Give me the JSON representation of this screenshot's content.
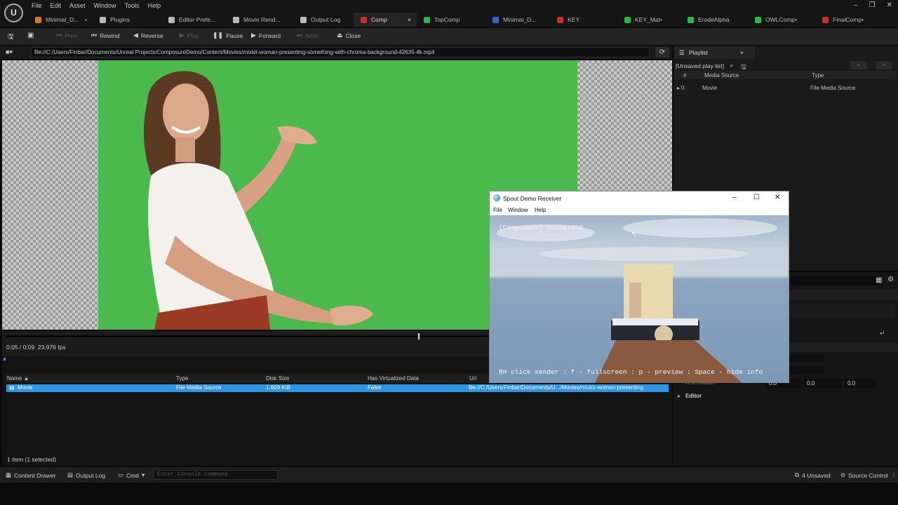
{
  "menubar": [
    "File",
    "Edit",
    "Asset",
    "Window",
    "Tools",
    "Help"
  ],
  "tabs": [
    {
      "label": "Minimal_D...",
      "suffix": "•",
      "color": "#d07a2a"
    },
    {
      "label": "Plugins",
      "suffix": "",
      "color": "#bbbbbb"
    },
    {
      "label": "Editor Prefe...",
      "suffix": "",
      "color": "#bbbbbb"
    },
    {
      "label": "Movie Rend...",
      "suffix": "",
      "color": "#bbbbbb"
    },
    {
      "label": "Output Log",
      "suffix": "",
      "color": "#bbbbbb"
    },
    {
      "label": "Comp",
      "suffix": "×",
      "color": "#c43030",
      "active": true
    },
    {
      "label": "TopComp",
      "suffix": "",
      "color": "#2fb34a"
    },
    {
      "label": "Minimal_D...",
      "suffix": "",
      "color": "#3b62c9"
    },
    {
      "label": "KEY",
      "suffix": "",
      "color": "#c43030"
    },
    {
      "label": "KEY_Mat•",
      "suffix": "",
      "color": "#2fb34a"
    },
    {
      "label": "ErodeAlpha",
      "suffix": "",
      "color": "#2fb34a"
    },
    {
      "label": "OWLComp•",
      "suffix": "",
      "color": "#2fb34a"
    },
    {
      "label": "FinalComp•",
      "suffix": "",
      "color": "#c43030"
    }
  ],
  "toolbar": {
    "prev": "Prev",
    "rewind": "Rewind",
    "reverse": "Reverse",
    "play": "Play",
    "pause": "Pause",
    "forward": "Forward",
    "next": "Next",
    "close": "Close"
  },
  "url": "file://C:/Users/Finbar/Documents/Unreal Projects/ComposureDemo/Content/Movies/mixkit-woman-presenting-something-with-chroma-background-42635-4k.mp4",
  "timeline": {
    "timecode": "0:05 / 0:09",
    "fps": "23.976 fps",
    "progress": 0.6217
  },
  "content_browser": {
    "columns": [
      "Name",
      "Type",
      "Disk Size",
      "Has Virtualized Data",
      "Url"
    ],
    "sort_marker": "▲",
    "rows": [
      {
        "name": "Movie",
        "type": "File Media Source",
        "size": "1.609 KiB",
        "virtualized": "False",
        "url": "file://C:/Users/Finbar/Documents/U.../Movies/mixkit-woman-presenting"
      }
    ],
    "count": "1 item (1 selected)"
  },
  "playlist": {
    "tab": "Playlist",
    "name": "[Unsaved play list]",
    "columns": [
      "#",
      "Media Source",
      "Type"
    ],
    "rows": [
      {
        "index": "0",
        "source": "Movie",
        "type": "File Media Source"
      }
    ]
  },
  "details": {
    "rotation_label": "View Rotation",
    "values": [
      "0.0",
      "0.0",
      "0.0"
    ],
    "section": "Editor"
  },
  "spout": {
    "title": "Spout Demo Receiver",
    "menu": [
      "File",
      "Window",
      "Help"
    ],
    "overlay_top": "[Composure] 1920x1080",
    "overlay_bottom": "RH click sender : f - fullscreen : p - preview : Space - hide info"
  },
  "statusbar": {
    "content_drawer": "Content Drawer",
    "output_log": "Output Log",
    "cmd": "Cmd",
    "console_placeholder": "Enter Console Command",
    "unsaved": "4 Unsaved",
    "source_control": "Source Control"
  }
}
